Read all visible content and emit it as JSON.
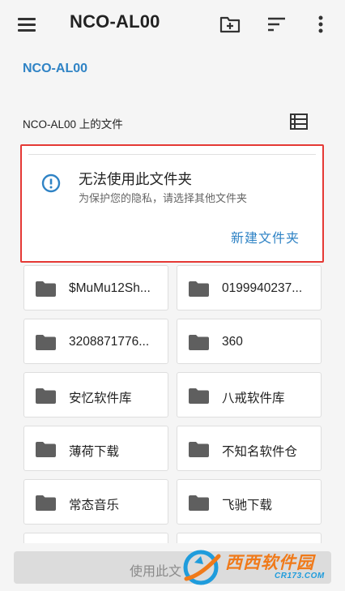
{
  "appbar": {
    "title": "NCO-AL00",
    "icons": [
      "menu-icon",
      "new-folder-icon",
      "sort-icon",
      "more-vert-icon"
    ]
  },
  "breadcrumb": "NCO-AL00",
  "section": {
    "title": "NCO-AL00 上的文件",
    "view_icon": "list-view-icon"
  },
  "notice": {
    "heading": "无法使用此文件夹",
    "sub": "为保护您的隐私，请选择其他文件夹",
    "action": "新建文件夹",
    "icon": "info-icon"
  },
  "folders": [
    {
      "name": "$MuMu12Sh..."
    },
    {
      "name": "0199940237..."
    },
    {
      "name": "3208871776..."
    },
    {
      "name": "360"
    },
    {
      "name": "安忆软件库"
    },
    {
      "name": "八戒软件库"
    },
    {
      "name": "薄荷下载"
    },
    {
      "name": "不知名软件仓"
    },
    {
      "name": "常态音乐"
    },
    {
      "name": "飞驰下载"
    }
  ],
  "bottom": {
    "button_label": "使用此文"
  },
  "watermark": {
    "brand": "西西软件园",
    "domain": "CR173.COM"
  },
  "colors": {
    "accent": "#2f83c5",
    "highlight_border": "#e53935",
    "folder_icon": "#5f5f5f",
    "watermark_orange": "#f07a1a",
    "watermark_blue": "#1f9cdc"
  }
}
